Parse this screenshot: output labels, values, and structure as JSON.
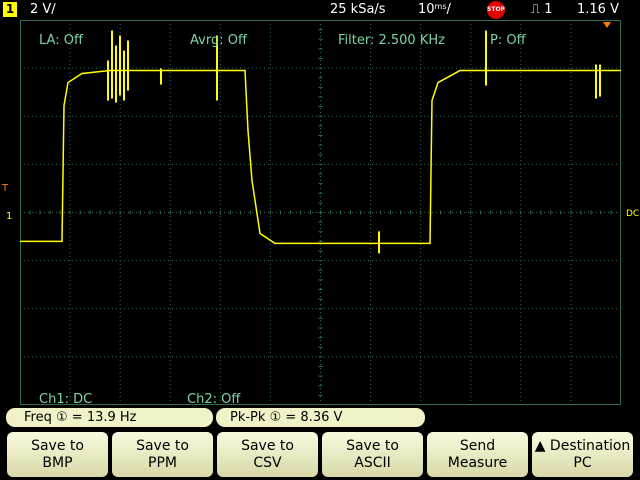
{
  "topbar": {
    "channel_number": "1",
    "channel_scale": "2 V/",
    "sample_rate": "25 kSa/s",
    "timebase_value": "10",
    "timebase_unit": "ms",
    "timebase_suffix": "/",
    "stop_badge": "STOP",
    "trigger_edge_symbol": "⎍",
    "trigger_source": "1",
    "trigger_level": "1.16  V"
  },
  "screen_labels": {
    "label_average": "LA: Off",
    "average": "Avrg: Off",
    "filter": "Filter: 2.500 KHz",
    "peak": "P: Off",
    "ch1": "Ch1: DC",
    "ch2": "Ch2: Off",
    "ground_marker": "1",
    "trigger_marker": "T",
    "coupling_marker": "DC"
  },
  "measurements": [
    {
      "name": "Freq",
      "channel": "①",
      "value": "13.9  Hz"
    },
    {
      "name": "Pk-Pk",
      "channel": "①",
      "value": "8.36  V"
    }
  ],
  "softkeys": [
    {
      "line1": "Save to",
      "line2": "BMP"
    },
    {
      "line1": "Save to",
      "line2": "PPM"
    },
    {
      "line1": "Save to",
      "line2": "CSV"
    },
    {
      "line1": "Save to",
      "line2": "ASCII"
    },
    {
      "line1": "Send",
      "line2": "Measure"
    },
    {
      "line1": "▲ Destination",
      "line2": "PC"
    }
  ],
  "colors": {
    "trace": "#ffff00",
    "grid": "#2f6e4f",
    "screen_text": "#7fd4a5",
    "key_face": "#f2f2c8",
    "stop": "#e10000"
  },
  "waveform": {
    "description_units": "divisions",
    "volts_per_div": 2,
    "ms_per_div": 10,
    "low_level_div": -0.6,
    "high_level_div": 2.95
  }
}
